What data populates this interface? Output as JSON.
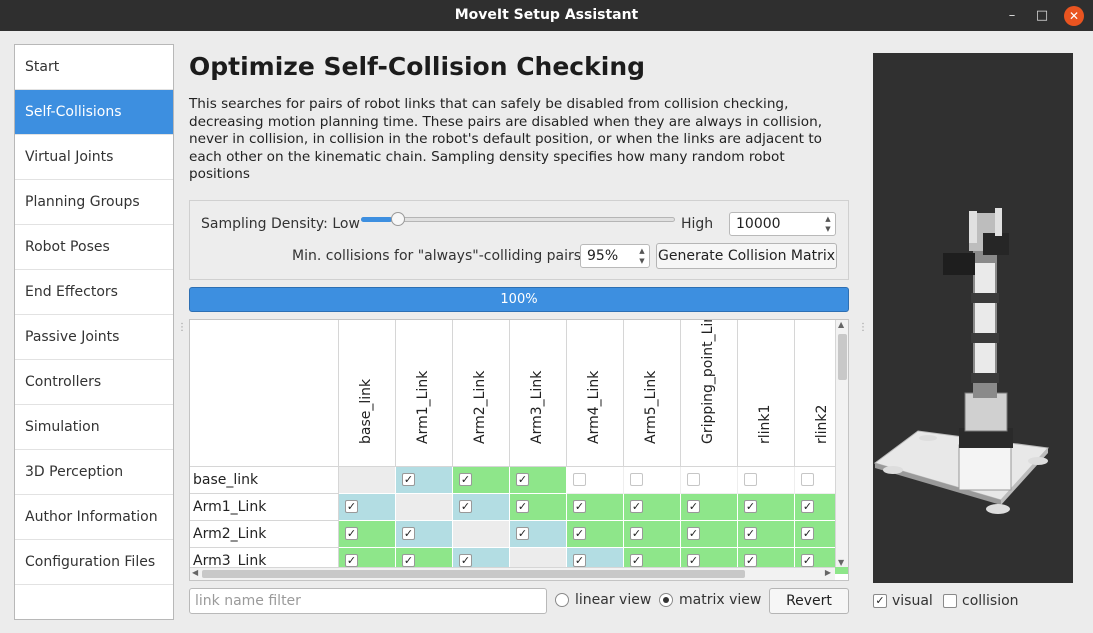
{
  "window": {
    "title": "MoveIt Setup Assistant",
    "min_symbol": "–",
    "max_symbol": "□",
    "close_symbol": "✕"
  },
  "nav": {
    "items": [
      {
        "label": "Start"
      },
      {
        "label": "Self-Collisions",
        "active": true
      },
      {
        "label": "Virtual Joints"
      },
      {
        "label": "Planning Groups"
      },
      {
        "label": "Robot Poses"
      },
      {
        "label": "End Effectors"
      },
      {
        "label": "Passive Joints"
      },
      {
        "label": "Controllers"
      },
      {
        "label": "Simulation"
      },
      {
        "label": "3D Perception"
      },
      {
        "label": "Author Information"
      },
      {
        "label": "Configuration Files"
      }
    ]
  },
  "page": {
    "title": "Optimize Self-Collision Checking",
    "description": "This searches for pairs of robot links that can safely be disabled from collision checking, decreasing motion planning time. These pairs are disabled when they are always in collision, never in collision, in collision in the robot's default position, or when the links are adjacent to each other on the kinematic chain. Sampling density specifies how many random robot positions"
  },
  "controls": {
    "density_label": "Sampling Density: Low",
    "high_label": "High",
    "density_value": "10000",
    "slider_fraction": 0.1,
    "min_collisions_label": "Min. collisions for \"always\"-colliding pairs:",
    "min_collisions_value": "95%",
    "generate_button": "Generate Collision Matrix"
  },
  "progress": {
    "text": "100%",
    "fraction": 1.0
  },
  "matrix": {
    "columns": [
      "base_link",
      "Arm1_Link",
      "Arm2_Link",
      "Arm3_Link",
      "Arm4_Link",
      "Arm5_Link",
      "Gripping_point_Link",
      "rlink1",
      "rlink2"
    ],
    "rows": [
      {
        "label": "base_link",
        "cells": [
          {
            "s": "gray",
            "c": false
          },
          {
            "s": "blue",
            "c": true
          },
          {
            "s": "green",
            "c": true
          },
          {
            "s": "green",
            "c": true
          },
          {
            "s": "white",
            "c": false
          },
          {
            "s": "white",
            "c": false
          },
          {
            "s": "white",
            "c": false
          },
          {
            "s": "white",
            "c": false
          },
          {
            "s": "white",
            "c": false
          }
        ]
      },
      {
        "label": "Arm1_Link",
        "cells": [
          {
            "s": "blue",
            "c": true
          },
          {
            "s": "gray",
            "c": false
          },
          {
            "s": "blue",
            "c": true
          },
          {
            "s": "green",
            "c": true
          },
          {
            "s": "green",
            "c": true
          },
          {
            "s": "green",
            "c": true
          },
          {
            "s": "green",
            "c": true
          },
          {
            "s": "green",
            "c": true
          },
          {
            "s": "green",
            "c": true
          }
        ]
      },
      {
        "label": "Arm2_Link",
        "cells": [
          {
            "s": "green",
            "c": true
          },
          {
            "s": "blue",
            "c": true
          },
          {
            "s": "gray",
            "c": false
          },
          {
            "s": "blue",
            "c": true
          },
          {
            "s": "green",
            "c": true
          },
          {
            "s": "green",
            "c": true
          },
          {
            "s": "green",
            "c": true
          },
          {
            "s": "green",
            "c": true
          },
          {
            "s": "green",
            "c": true
          }
        ]
      },
      {
        "label": "Arm3_Link",
        "cells": [
          {
            "s": "green",
            "c": true
          },
          {
            "s": "green",
            "c": true
          },
          {
            "s": "blue",
            "c": true
          },
          {
            "s": "gray",
            "c": false
          },
          {
            "s": "blue",
            "c": true
          },
          {
            "s": "green",
            "c": true
          },
          {
            "s": "green",
            "c": true
          },
          {
            "s": "green",
            "c": true
          },
          {
            "s": "green",
            "c": true
          }
        ]
      }
    ]
  },
  "bottom": {
    "filter_placeholder": "link name filter",
    "linear_view_label": "linear view",
    "matrix_view_label": "matrix view",
    "view_mode": "matrix",
    "revert_button": "Revert"
  },
  "viewer": {
    "visual_label": "visual",
    "visual_checked": true,
    "collision_label": "collision",
    "collision_checked": false
  }
}
